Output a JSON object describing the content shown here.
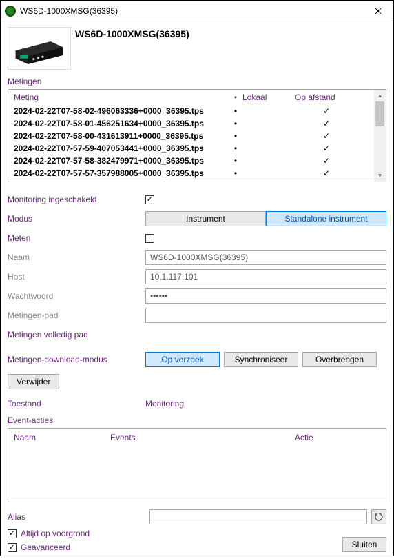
{
  "window": {
    "title": "WS6D-1000XMSG(36395)"
  },
  "header": {
    "device_title": "WS6D-1000XMSG(36395)"
  },
  "measurements": {
    "section": "Metingen",
    "headers": {
      "meting": "Meting",
      "lokaal": "Lokaal",
      "opafstand": "Op afstand"
    },
    "rows": [
      {
        "name": "2024-02-22T07-58-02-496063336+0000_36395.tps",
        "dot": "•",
        "lokaal": "",
        "opafstand": "✓"
      },
      {
        "name": "2024-02-22T07-58-01-456251634+0000_36395.tps",
        "dot": "•",
        "lokaal": "",
        "opafstand": "✓"
      },
      {
        "name": "2024-02-22T07-58-00-431613911+0000_36395.tps",
        "dot": "•",
        "lokaal": "",
        "opafstand": "✓"
      },
      {
        "name": "2024-02-22T07-57-59-407053441+0000_36395.tps",
        "dot": "•",
        "lokaal": "",
        "opafstand": "✓"
      },
      {
        "name": "2024-02-22T07-57-58-382479971+0000_36395.tps",
        "dot": "•",
        "lokaal": "",
        "opafstand": "✓"
      },
      {
        "name": "2024-02-22T07-57-57-357988005+0000_36395.tps",
        "dot": "•",
        "lokaal": "",
        "opafstand": "✓"
      }
    ]
  },
  "form": {
    "monitoring_label": "Monitoring ingeschakeld",
    "monitoring_checked": true,
    "modus_label": "Modus",
    "modus_opt1": "Instrument",
    "modus_opt2": "Standalone instrument",
    "meten_label": "Meten",
    "meten_checked": false,
    "naam_label": "Naam",
    "naam_value": "WS6D-1000XMSG(36395)",
    "host_label": "Host",
    "host_value": "10.1.117.101",
    "wachtwoord_label": "Wachtwoord",
    "wachtwoord_value": "••••••",
    "metingenpad_label": "Metingen-pad",
    "metingenpad_value": "",
    "volledigpad_label": "Metingen volledig pad",
    "dl_label": "Metingen-download-modus",
    "dl_opt1": "Op verzoek",
    "dl_opt2": "Synchroniseer",
    "dl_opt3": "Overbrengen",
    "verwijder": "Verwijder",
    "toestand_label": "Toestand",
    "toestand_value": "Monitoring"
  },
  "events": {
    "section": "Event-acties",
    "col_naam": "Naam",
    "col_events": "Events",
    "col_actie": "Actie"
  },
  "footer": {
    "alias_label": "Alias",
    "alias_value": "",
    "altijd_label": "Altijd op voorgrond",
    "altijd_checked": true,
    "geavanceerd_label": "Geavanceerd",
    "geavanceerd_checked": true,
    "sluiten": "Sluiten"
  }
}
